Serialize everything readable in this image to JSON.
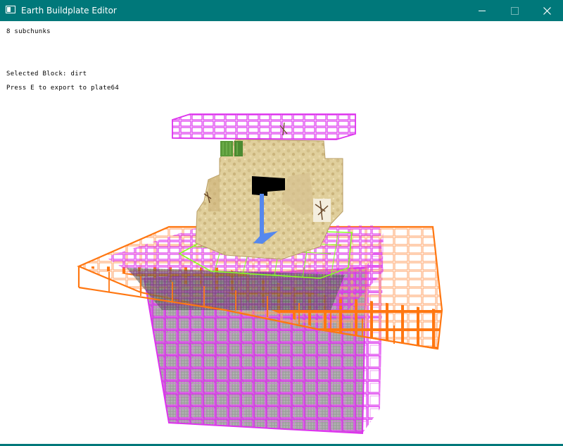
{
  "window": {
    "title": "Earth Buildplate Editor",
    "icons": {
      "app": "app-window-icon",
      "minimize": "minimize-icon",
      "maximize": "maximize-icon",
      "close": "close-icon"
    },
    "colors": {
      "titlebar": "#00787a",
      "title_text": "#ffffff"
    }
  },
  "hud": {
    "subchunks": "8 subchunks",
    "selected_block": "Selected Block: dirt",
    "export_hint": "Press E to export to plate64"
  },
  "scene": {
    "colors": {
      "subchunk_outline": "#dd33ee",
      "selected_layer_outline": "#ff7711",
      "highlight_outline": "#88ff22",
      "cursor_block": "#000000",
      "axis": "#5588ee",
      "sandstone": "#e0cf9c",
      "sandstone_dark": "#c8b27c",
      "stone": "#6a6a6a",
      "cactus": "#5a9a3a"
    }
  }
}
